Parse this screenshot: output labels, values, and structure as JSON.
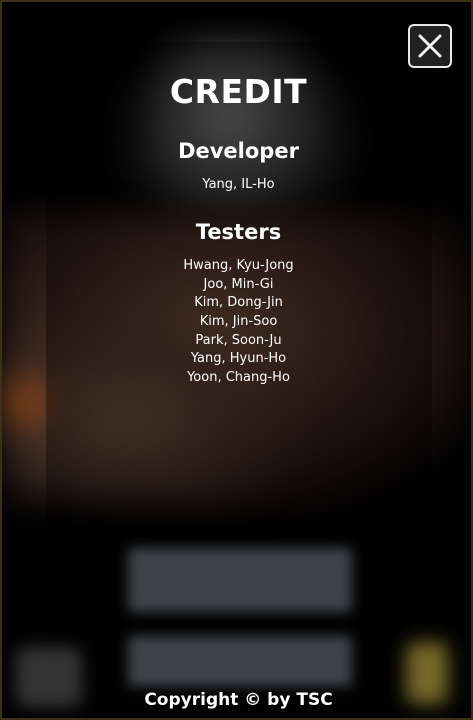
{
  "credits": {
    "title": "CREDIT",
    "developer_heading": "Developer",
    "developer_name": "Yang, IL-Ho",
    "testers_heading": "Testers",
    "testers": [
      "Hwang, Kyu-Jong",
      "Joo, Min-Gi",
      "Kim, Dong-Jin",
      "Kim, Jin-Soo",
      "Park, Soon-Ju",
      "Yang, Hyun-Ho",
      "Yoon, Chang-Ho"
    ]
  },
  "footer": {
    "copyright": "Copyright © by TSC"
  },
  "icons": {
    "close": "close-icon"
  },
  "colors": {
    "text": "#ffffff",
    "frame_border": "#3a3117",
    "background": "#000000"
  }
}
